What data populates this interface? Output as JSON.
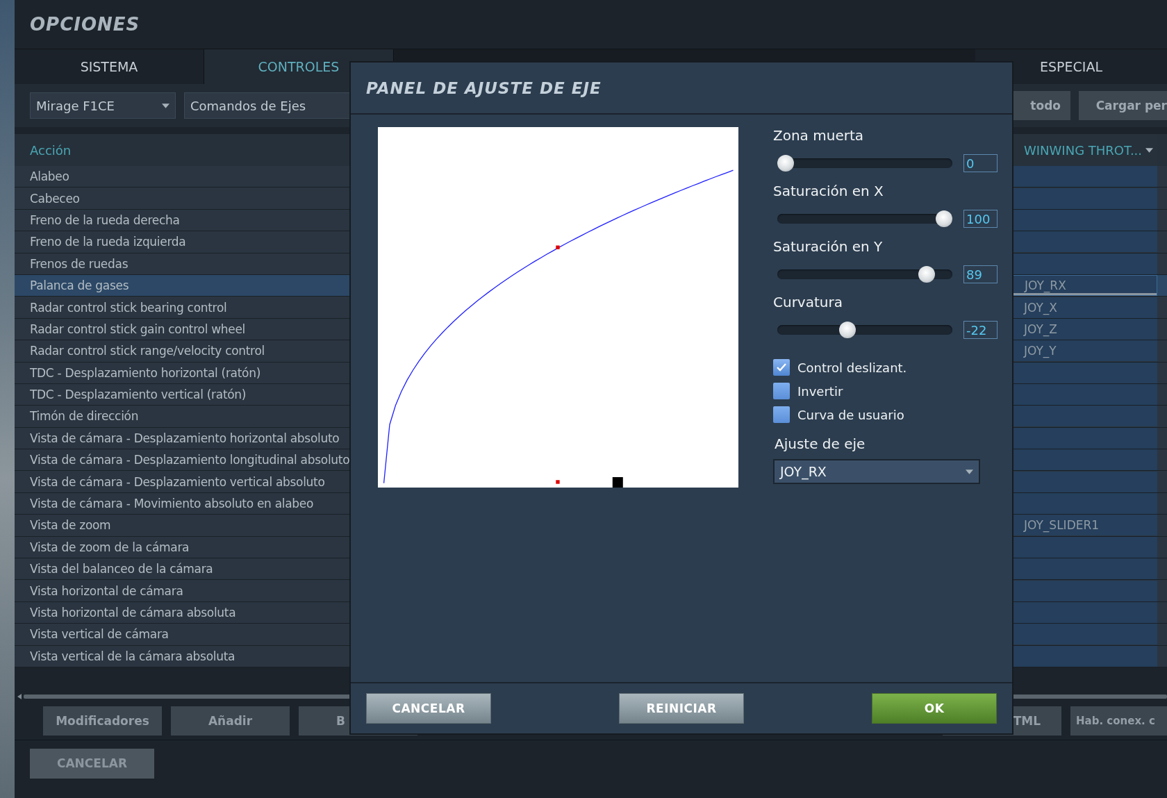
{
  "title": "OPCIONES",
  "tabs": [
    {
      "label": "SISTEMA",
      "selected": false
    },
    {
      "label": "CONTROLES",
      "selected": true
    },
    {
      "label": "ESPECIAL",
      "selected": false
    }
  ],
  "filters": {
    "aircraft": "Mirage F1CE",
    "category": "Comandos de Ejes"
  },
  "toolbar_buttons": [
    "todo",
    "Cargar per"
  ],
  "table": {
    "columns": [
      "Acción",
      "WINWING THROT..."
    ],
    "rows": [
      {
        "action": "Alabeo",
        "selected": false
      },
      {
        "action": "Cabeceo",
        "selected": false
      },
      {
        "action": "Freno de la rueda derecha",
        "selected": false
      },
      {
        "action": "Freno de la rueda izquierda",
        "selected": false
      },
      {
        "action": "Frenos de ruedas",
        "selected": false
      },
      {
        "action": "Palanca de gases",
        "column_2": "JOY_RX",
        "selected": true
      },
      {
        "action": "Radar control stick bearing control",
        "column_2": "JOY_X",
        "selected": false
      },
      {
        "action": "Radar control stick gain control wheel",
        "column_2": "JOY_Z",
        "selected": false
      },
      {
        "action": "Radar control stick range/velocity control",
        "column_2": "JOY_Y",
        "selected": false
      },
      {
        "action": "TDC - Desplazamiento horizontal (ratón)",
        "selected": false
      },
      {
        "action": "TDC - Desplazamiento vertical (ratón)",
        "selected": false
      },
      {
        "action": "Timón de dirección",
        "selected": false
      },
      {
        "action": "Vista de cámara - Desplazamiento horizontal absoluto",
        "selected": false
      },
      {
        "action": "Vista de cámara - Desplazamiento longitudinal absoluto",
        "selected": false
      },
      {
        "action": "Vista de cámara - Desplazamiento vertical absoluto",
        "selected": false
      },
      {
        "action": "Vista de cámara - Movimiento absoluto en alabeo",
        "selected": false
      },
      {
        "action": "Vista de zoom",
        "column_2": "JOY_SLIDER1",
        "selected": false
      },
      {
        "action": "Vista de zoom de la cámara",
        "selected": false
      },
      {
        "action": "Vista del balanceo de la cámara",
        "selected": false
      },
      {
        "action": "Vista horizontal de cámara",
        "selected": false
      },
      {
        "action": "Vista horizontal de cámara absoluta",
        "selected": false
      },
      {
        "action": "Vista vertical de cámara",
        "selected": false
      },
      {
        "action": "Vista vertical de la cámara absoluta",
        "selected": false
      }
    ]
  },
  "bottom_buttons": [
    "Modificadores",
    "Añadir",
    "B",
    "TML",
    "Hab. conex. c"
  ],
  "cancel_button": "CANCELAR",
  "dialog": {
    "title": "PANEL DE AJUSTE DE EJE",
    "sliders": [
      {
        "label": "Zona muerta",
        "level": 0,
        "reading": "0"
      },
      {
        "label": "Saturación en X",
        "level": 1,
        "reading": "100"
      },
      {
        "label": "Saturación en Y",
        "level": 0.89,
        "reading": "89"
      },
      {
        "label": "Curvatura",
        "level": 0.39,
        "reading": "-22"
      }
    ],
    "checkboxes": [
      {
        "label": "Control deslizant.",
        "checked": true
      },
      {
        "label": "Invertir",
        "checked": false
      },
      {
        "label": "Curva de usuario",
        "checked": false
      }
    ],
    "axis_label": "Ajuste de eje",
    "axis_value": "JOY_RX",
    "buttons": [
      {
        "label": "CANCELAR",
        "kind": "secondary"
      },
      {
        "label": "REINICIAR",
        "kind": "secondary"
      },
      {
        "label": "OK",
        "kind": "primary"
      }
    ]
  }
}
